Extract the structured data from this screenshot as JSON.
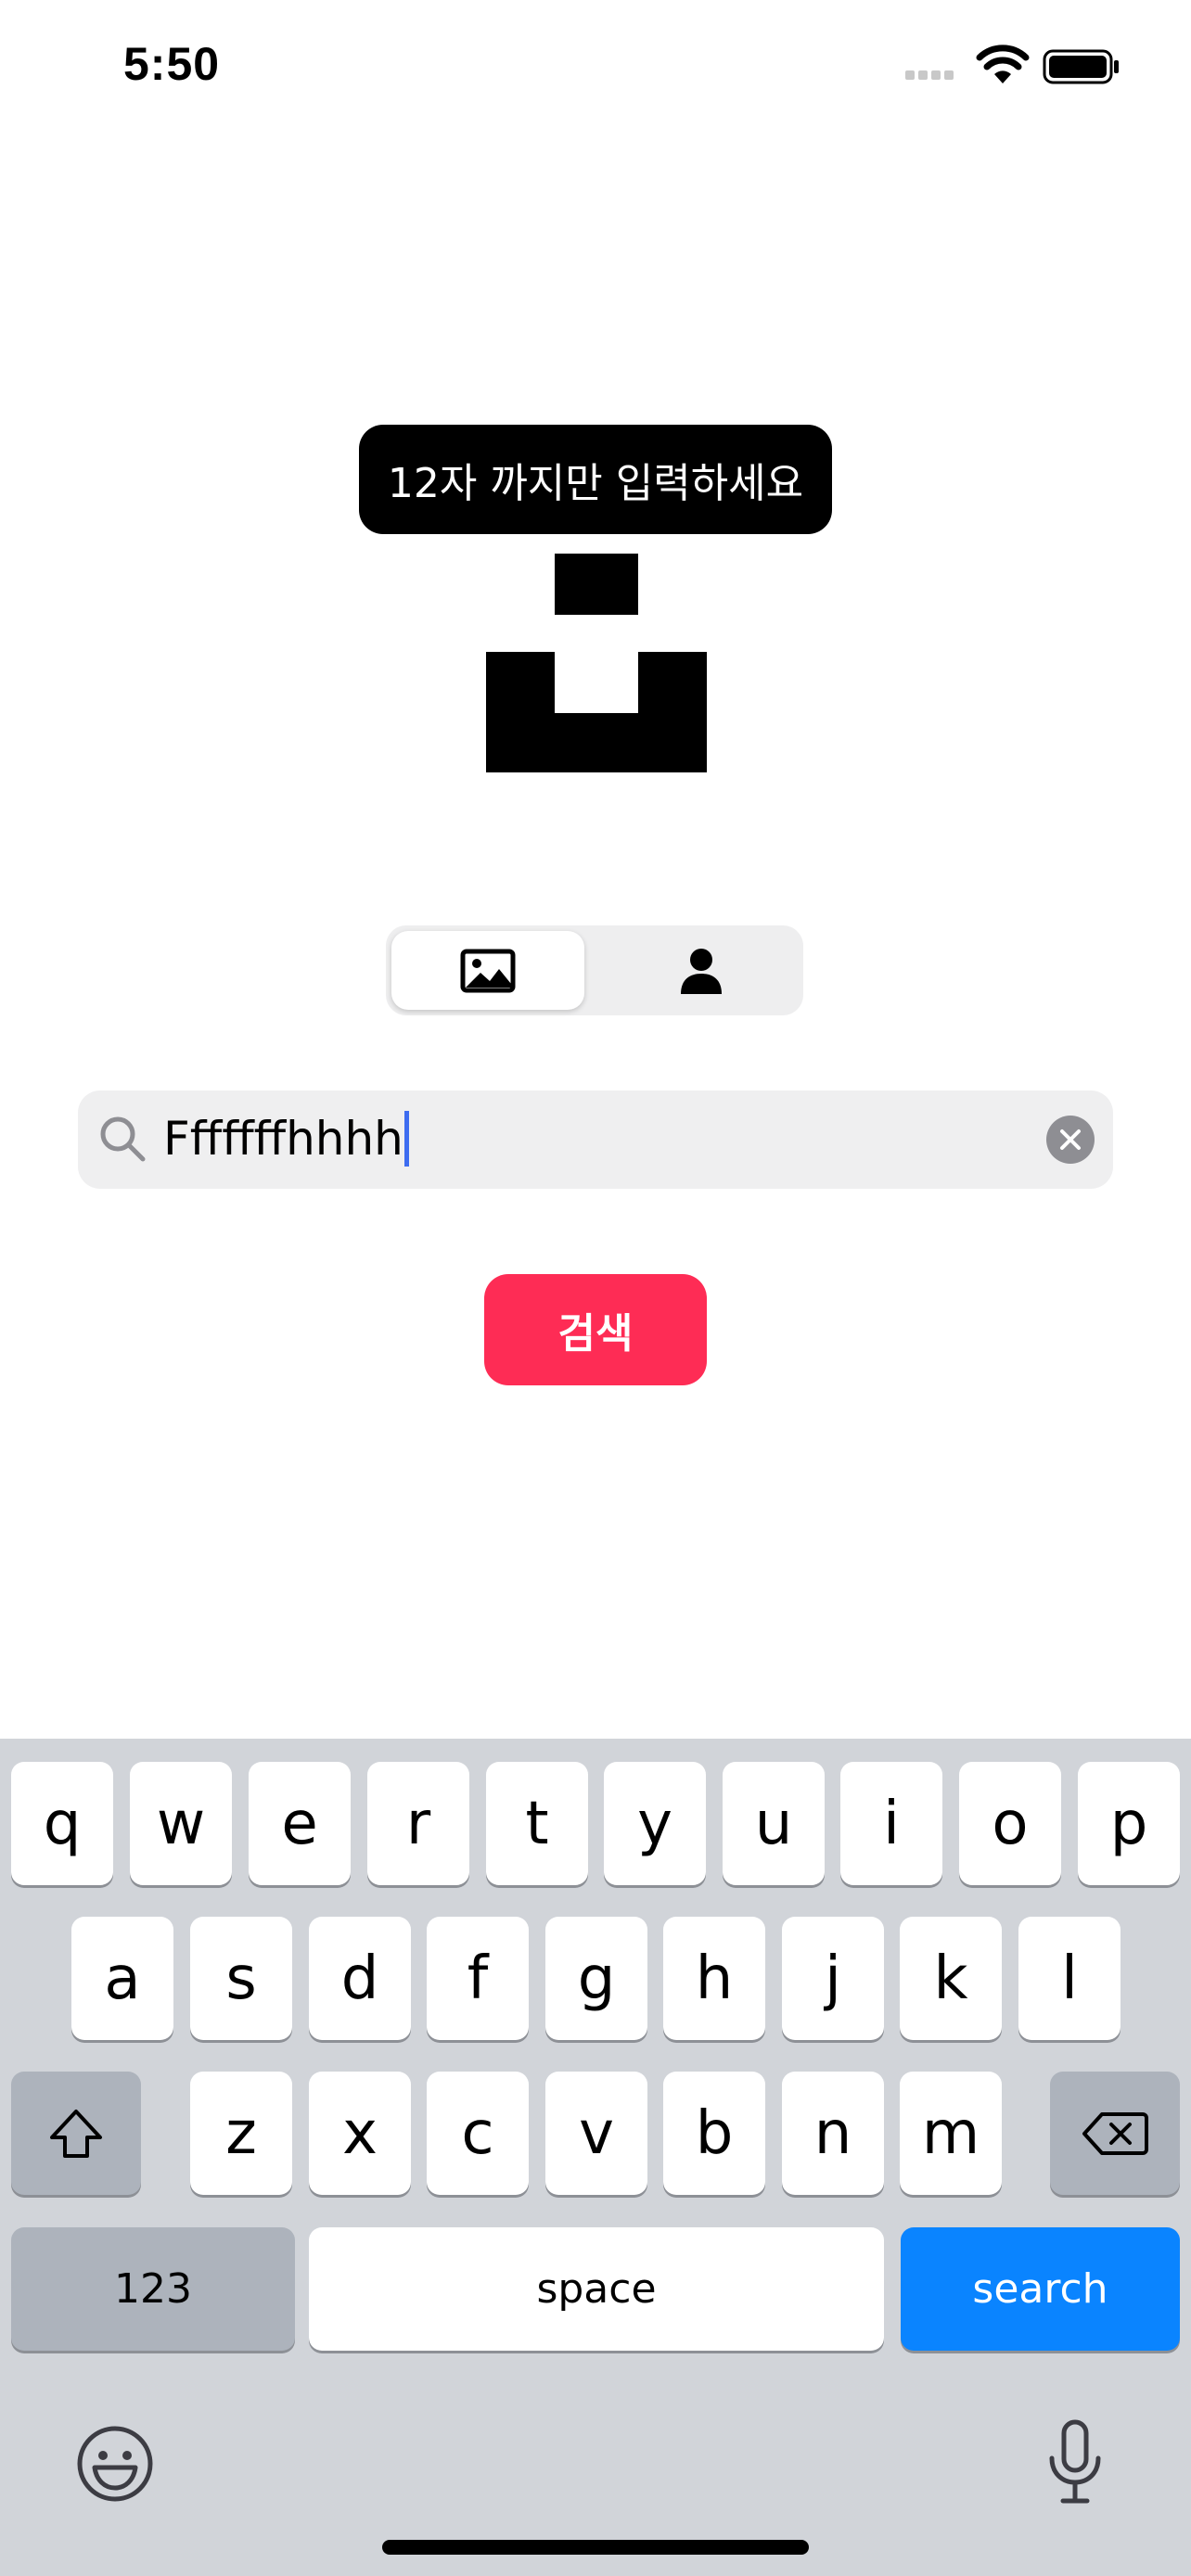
{
  "status_bar": {
    "time": "5:50"
  },
  "tooltip": {
    "text": "12자 까지만 입력하세요"
  },
  "segmented": {
    "options": [
      "photo-icon",
      "person-icon"
    ],
    "selected_index": 0
  },
  "search": {
    "value": "Fffffffhhhh"
  },
  "search_button": {
    "label": "검색"
  },
  "keyboard": {
    "row1": [
      "q",
      "w",
      "e",
      "r",
      "t",
      "y",
      "u",
      "i",
      "o",
      "p"
    ],
    "row2": [
      "a",
      "s",
      "d",
      "f",
      "g",
      "h",
      "j",
      "k",
      "l"
    ],
    "row3": [
      "z",
      "x",
      "c",
      "v",
      "b",
      "n",
      "m"
    ],
    "numbers_label": "123",
    "space_label": "space",
    "return_label": "search"
  },
  "colors": {
    "accent_red": "#fe2c55",
    "return_blue": "#0a84ff",
    "caret_blue": "#3d6cf0"
  }
}
